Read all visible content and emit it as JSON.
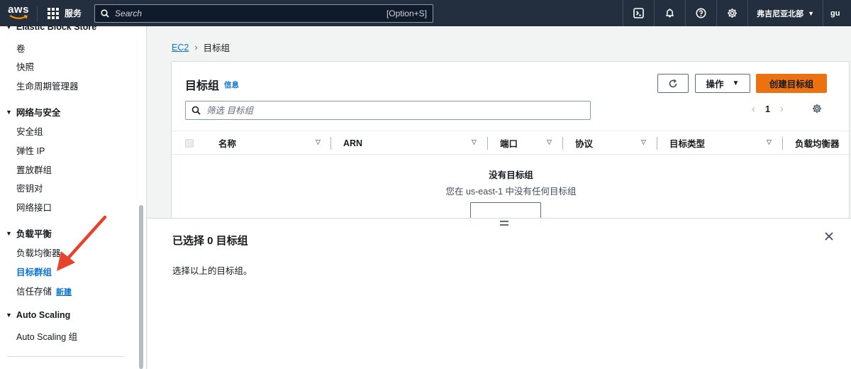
{
  "topnav": {
    "logo": "aws",
    "services_label": "服务",
    "search_placeholder": "Search",
    "search_shortcut": "[Option+S]",
    "region": "弗吉尼亚北部",
    "account": "gu",
    "icons": [
      "cloudshell-icon",
      "bell-icon",
      "help-icon",
      "gear-icon"
    ]
  },
  "sidebar": {
    "partial_header": "Elastic Block Store",
    "ebs_items": [
      "卷",
      "快照",
      "生命周期管理器"
    ],
    "network_header": "网络与安全",
    "network_items": [
      "安全组",
      "弹性 IP",
      "置放群组",
      "密钥对",
      "网络接口"
    ],
    "lb_header": "负载平衡",
    "lb_items": [
      "负载均衡器",
      "目标群组",
      "信任存储"
    ],
    "lb_active": "目标群组",
    "new_badge": "新建",
    "as_header": "Auto Scaling",
    "as_items": [
      "Auto Scaling 组"
    ]
  },
  "breadcrumb": {
    "root": "EC2",
    "current": "目标组"
  },
  "card": {
    "title": "目标组",
    "info": "信息",
    "actions_label": "操作",
    "create_label": "创建目标组",
    "filter_placeholder": "筛选 目标组",
    "page": "1",
    "columns": [
      "名称",
      "ARN",
      "端口",
      "协议",
      "目标类型",
      "负载均衡器"
    ],
    "empty_title": "没有目标组",
    "empty_desc": "您在 us-east-1 中没有任何目标组"
  },
  "split_panel": {
    "title": "已选择 0 目标组",
    "text": "选择以上的目标组。"
  },
  "colors": {
    "nav_bg": "#232f3e",
    "accent_link": "#0972d3",
    "primary_button": "#ec7211",
    "annotation_arrow": "#e8412c"
  }
}
